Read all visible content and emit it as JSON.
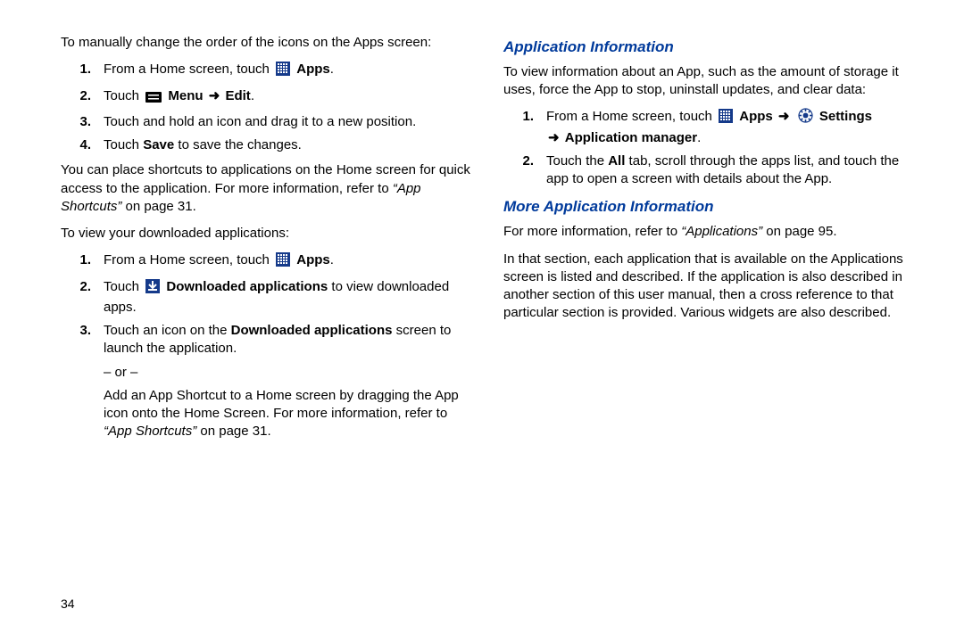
{
  "left": {
    "intro": "To manually change the order of the icons on the Apps screen:",
    "steps_a": [
      {
        "pre": "From a Home screen, touch ",
        "icon": "apps",
        "post_bold": "Apps",
        "suffix": "."
      },
      {
        "pre": "Touch ",
        "icon": "menu",
        "post_bold": "Menu",
        "arrow": true,
        "post_bold2": "Edit",
        "suffix": "."
      },
      {
        "plain": "Touch and hold an icon and drag it to a new position."
      },
      {
        "pre": "Touch ",
        "post_bold": "Save",
        "suffix": " to save the changes."
      }
    ],
    "shortcut_para_a": "You can place shortcuts to applications on the Home screen for quick access to the application. For more information, refer to ",
    "shortcut_ref": "“App Shortcuts”",
    "shortcut_para_b": " on page 31.",
    "view_intro": "To view your downloaded applications:",
    "steps_b": {
      "s1_pre": "From a Home screen, touch ",
      "s1_bold": "Apps",
      "s2_pre": "Touch ",
      "s2_bold": "Downloaded applications",
      "s2_post": " to view downloaded apps.",
      "s3_pre": "Touch an icon on the ",
      "s3_bold": "Downloaded applications",
      "s3_post": " screen to launch the application.",
      "or": "– or –",
      "s3_alt_a": "Add an App Shortcut to a Home screen by dragging the App icon onto the Home Screen. For more information, refer to ",
      "s3_alt_ref": "“App Shortcuts”",
      "s3_alt_b": " on page 31."
    }
  },
  "right": {
    "h1": "Application Information",
    "p1": "To view information about an App, such as the amount of storage it uses, force the App to stop, uninstall updates, and clear data:",
    "s1_pre": "From a Home screen, touch ",
    "s1_b1": "Apps",
    "s1_b2": "Settings",
    "s1_line2_b": "Application manager",
    "s2_pre": "Touch the ",
    "s2_b": "All",
    "s2_post": " tab, scroll through the apps list, and touch the app to open a screen with details about the App.",
    "h2": "More Application Information",
    "p2a": "For more information, refer to ",
    "p2ref": "“Applications”",
    "p2b": " on page 95.",
    "p3": "In that section, each application that is available on the Applications screen is listed and described. If the application is also described in another section of this user manual, then a cross reference to that particular section is provided. Various widgets are also described."
  },
  "page_number": "34",
  "arrow_glyph": "➜"
}
